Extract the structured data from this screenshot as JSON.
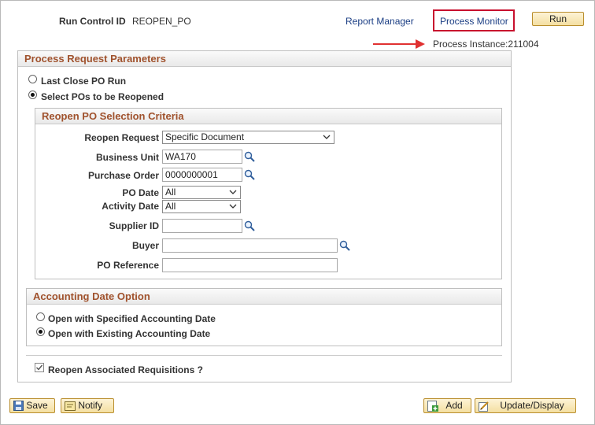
{
  "header": {
    "run_control_label": "Run Control ID",
    "run_control_value": "REOPEN_PO",
    "report_manager": "Report Manager",
    "process_monitor": "Process Monitor",
    "run": "Run",
    "process_instance": "Process Instance:211004"
  },
  "params": {
    "title": "Process Request Parameters",
    "option1": "Last Close PO Run",
    "option2": "Select POs to be Reopened"
  },
  "criteria": {
    "title": "Reopen PO Selection Criteria",
    "reopen_request_label": "Reopen Request",
    "reopen_request_value": "Specific Document",
    "business_unit_label": "Business Unit",
    "business_unit_value": "WA170",
    "purchase_order_label": "Purchase Order",
    "purchase_order_value": "0000000001",
    "po_date_label": "PO Date",
    "po_date_value": "All",
    "activity_date_label": "Activity Date",
    "activity_date_value": "All",
    "supplier_id_label": "Supplier ID",
    "supplier_id_value": "",
    "buyer_label": "Buyer",
    "buyer_value": "",
    "po_reference_label": "PO Reference",
    "po_reference_value": ""
  },
  "accounting": {
    "title": "Accounting Date Option",
    "option1": "Open with Specified Accounting Date",
    "option2": "Open with Existing Accounting Date"
  },
  "reopen_requisitions": "Reopen Associated Requisitions ?",
  "footer": {
    "save": "Save",
    "notify": "Notify",
    "add": "Add",
    "update_display": "Update/Display"
  },
  "colors": {
    "highlight": "#c8102e",
    "section_title": "#a0522d",
    "link": "#1b3e84"
  }
}
